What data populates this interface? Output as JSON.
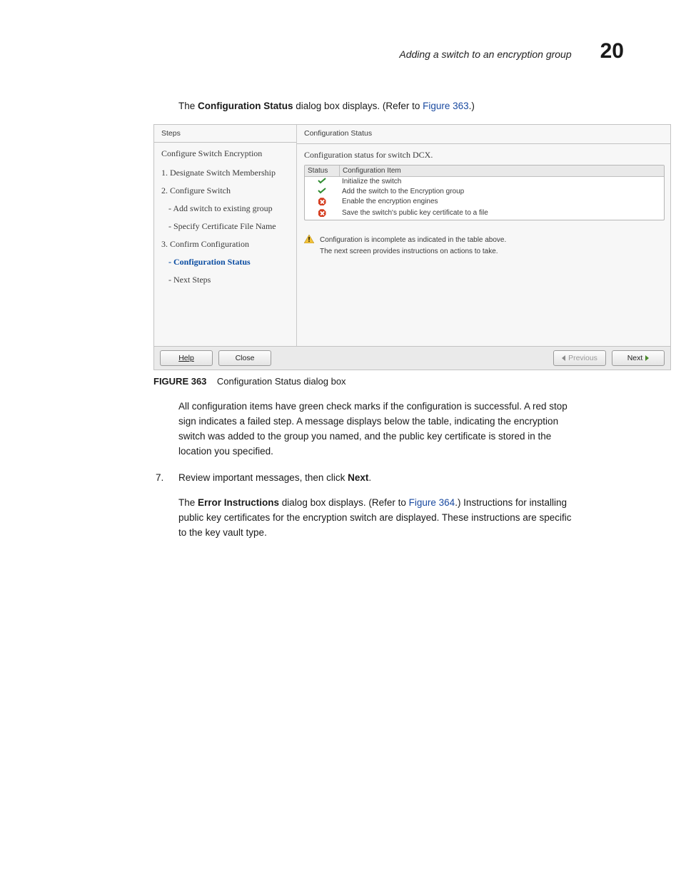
{
  "header": {
    "title": "Adding a switch to an encryption group",
    "chapter": "20"
  },
  "intro": {
    "pre": "The ",
    "bold": "Configuration Status",
    "mid": " dialog box displays. (Refer to ",
    "link": "Figure 363",
    "post": ".)"
  },
  "dialog": {
    "left": {
      "panel_title": "Steps",
      "heading": "Configure Switch Encryption",
      "steps": [
        "1. Designate Switch Membership",
        "2. Configure Switch",
        "- Add switch to existing group",
        "- Specify Certificate File Name",
        "3. Confirm Configuration",
        "- Configuration Status",
        "- Next Steps"
      ]
    },
    "right": {
      "panel_title": "Configuration Status",
      "caption": "Configuration status for switch DCX.",
      "columns": {
        "c1": "Status",
        "c2": "Configuration Item"
      },
      "rows": [
        {
          "status": "ok",
          "item": "Initialize the switch"
        },
        {
          "status": "ok",
          "item": "Add the switch to the Encryption group"
        },
        {
          "status": "fail",
          "item": "Enable the encryption engines"
        },
        {
          "status": "fail",
          "item": "Save the switch's public key certificate to a file"
        }
      ],
      "message1": "Configuration is incomplete as indicated in the table above.",
      "message2": "The next screen provides instructions on actions to take."
    },
    "buttons": {
      "help": "Help",
      "close": "Close",
      "prev": "Previous",
      "next": "Next"
    }
  },
  "figure_caption": {
    "label": "FIGURE 363",
    "text": "Configuration Status dialog box"
  },
  "para1": "All configuration items have green check marks if the configuration is successful. A red stop sign indicates a failed step. A message displays below the table, indicating the encryption switch was added to the group you named, and the public key certificate is stored in the location you specified.",
  "list7": {
    "num": "7.",
    "pre": "Review important messages, then click ",
    "bold": "Next",
    "post": "."
  },
  "para2": {
    "pre": "The ",
    "bold": "Error Instructions",
    "mid": " dialog box displays. (Refer to ",
    "link": "Figure 364",
    "post": ".) Instructions for installing public key certificates for the encryption switch are displayed. These instructions are specific to the key vault type."
  }
}
